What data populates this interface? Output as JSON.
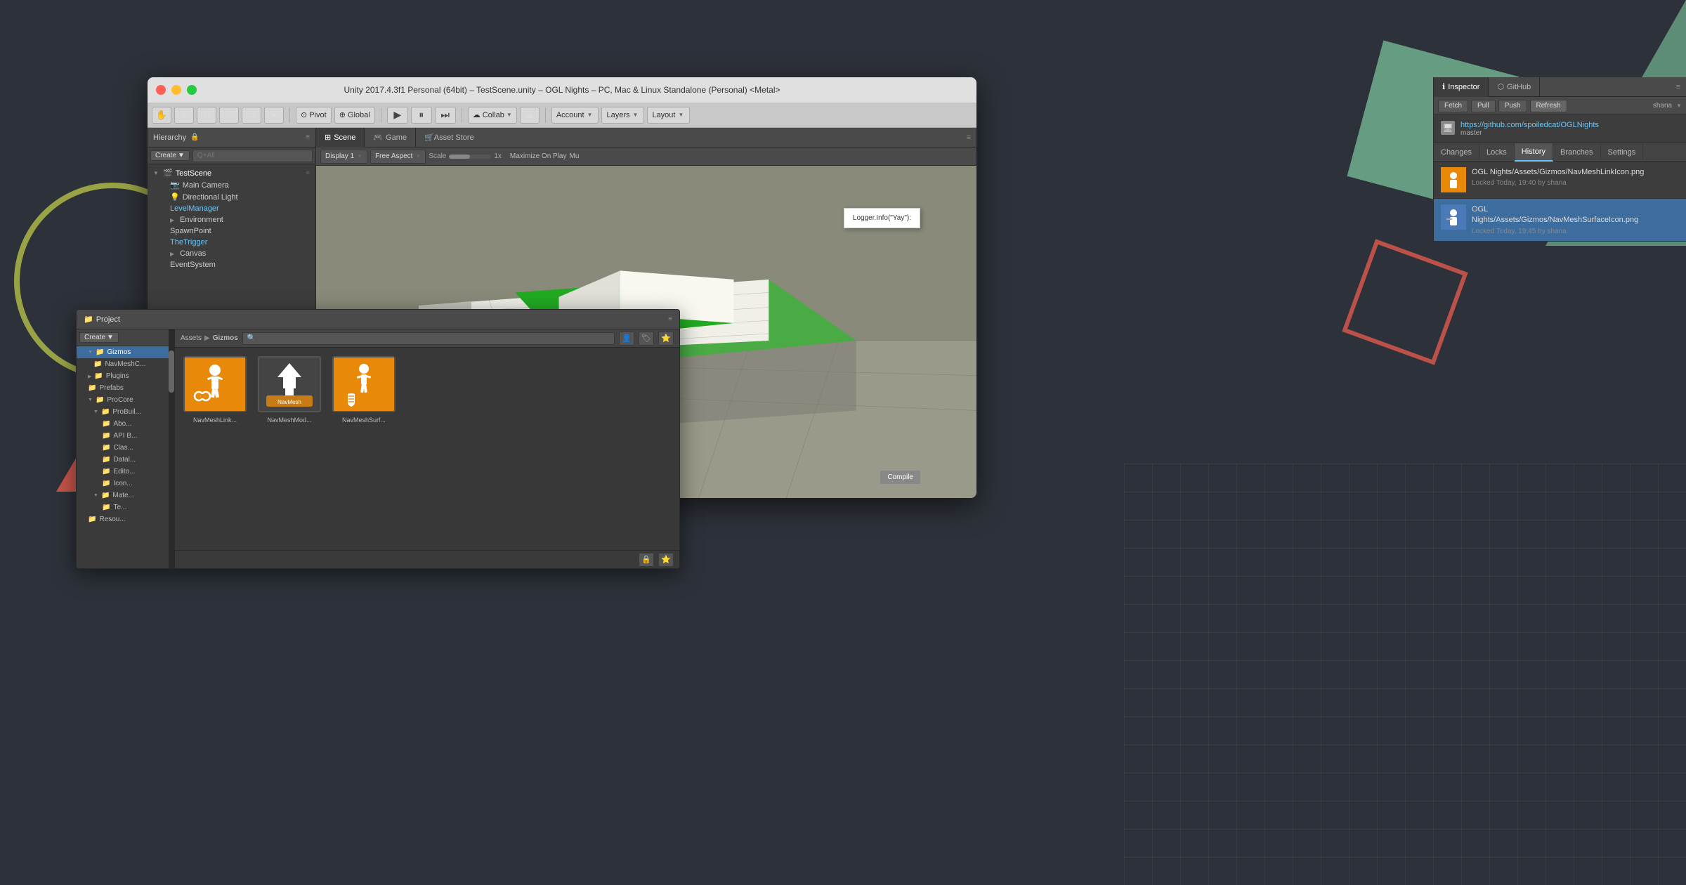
{
  "window": {
    "title": "Unity 2017.4.3f1 Personal (64bit) – TestScene.unity – OGL Nights – PC, Mac & Linux Standalone (Personal) <Metal>"
  },
  "toolbar": {
    "pivot_label": "Pivot",
    "global_label": "Global",
    "collab_label": "Collab",
    "account_label": "Account",
    "layers_label": "Layers",
    "layout_label": "Layout"
  },
  "hierarchy": {
    "tab_label": "Hierarchy",
    "create_label": "Create",
    "search_placeholder": "Q+All",
    "scene_name": "TestScene",
    "items": [
      {
        "label": "Main Camera",
        "type": "child",
        "color": "normal"
      },
      {
        "label": "Directional Light",
        "type": "child",
        "color": "normal"
      },
      {
        "label": "LevelManager",
        "type": "child",
        "color": "blue"
      },
      {
        "label": "Environment",
        "type": "child-expand",
        "color": "normal"
      },
      {
        "label": "SpawnPoint",
        "type": "child",
        "color": "normal"
      },
      {
        "label": "TheTrigger",
        "type": "child",
        "color": "blue"
      },
      {
        "label": "Canvas",
        "type": "child-expand",
        "color": "normal"
      },
      {
        "label": "EventSystem",
        "type": "child",
        "color": "normal"
      }
    ]
  },
  "scene": {
    "tabs": [
      {
        "label": "Scene",
        "icon": "⊞",
        "active": true
      },
      {
        "label": "Game",
        "icon": "🎮",
        "active": false
      },
      {
        "label": "Asset Store",
        "icon": "🛒",
        "active": false
      }
    ],
    "display_label": "Display 1",
    "aspect_label": "Free Aspect",
    "scale_label": "Scale",
    "scale_value": "1x",
    "maximize_label": "Maximize On Play",
    "mute_label": "Mu",
    "logger_text": "Logger.Info(\"Yay\"):",
    "compile_label": "Compile"
  },
  "inspector": {
    "tab_label": "Inspector",
    "github_tab_label": "GitHub"
  },
  "github": {
    "fetch_label": "Fetch",
    "pull_label": "Pull",
    "push_label": "Push",
    "refresh_label": "Refresh",
    "user_label": "shana",
    "repo_url": "https://github.com/spoiledcat/OGLNights",
    "branch": "master",
    "nav_tabs": [
      "Changes",
      "Locks",
      "History",
      "Branches",
      "Settings"
    ],
    "active_tab": "History",
    "files": [
      {
        "name": "OGL Nights/Assets/Gizmos/NavMeshLinkIcon.png",
        "meta": "Locked Today, 19:40 by shana",
        "selected": false
      },
      {
        "name": "OGL\nNights/Assets/Gizmos/NavMeshSurfaceIcon.png",
        "meta": "Locked Today, 19:45 by shana",
        "selected": true
      }
    ]
  },
  "project": {
    "title": "Project",
    "create_label": "Create",
    "breadcrumb": [
      "Assets",
      "Gizmos"
    ],
    "sidebar_items": [
      {
        "label": "Gizmos",
        "selected": true,
        "indent": 0
      },
      {
        "label": "NavMeshC...",
        "selected": false,
        "indent": 1
      },
      {
        "label": "Plugins",
        "selected": false,
        "indent": 0
      },
      {
        "label": "Prefabs",
        "selected": false,
        "indent": 0
      },
      {
        "label": "ProCore",
        "selected": false,
        "indent": 0
      },
      {
        "label": "ProBuil...",
        "selected": false,
        "indent": 1
      },
      {
        "label": "Abo...",
        "selected": false,
        "indent": 2
      },
      {
        "label": "API B...",
        "selected": false,
        "indent": 2
      },
      {
        "label": "Clas...",
        "selected": false,
        "indent": 2
      },
      {
        "label": "Datal...",
        "selected": false,
        "indent": 2
      },
      {
        "label": "Edito...",
        "selected": false,
        "indent": 2
      },
      {
        "label": "Icon...",
        "selected": false,
        "indent": 2
      },
      {
        "label": "Mate...",
        "selected": false,
        "indent": 1
      },
      {
        "label": "Te...",
        "selected": false,
        "indent": 2
      },
      {
        "label": "Resou...",
        "selected": false,
        "indent": 0
      }
    ],
    "assets": [
      {
        "label": "NavMeshLink...",
        "type": "navmesh-link"
      },
      {
        "label": "NavMeshMod...",
        "type": "navmesh-mod"
      },
      {
        "label": "NavMeshSurf...",
        "type": "navmesh-surf"
      }
    ]
  }
}
